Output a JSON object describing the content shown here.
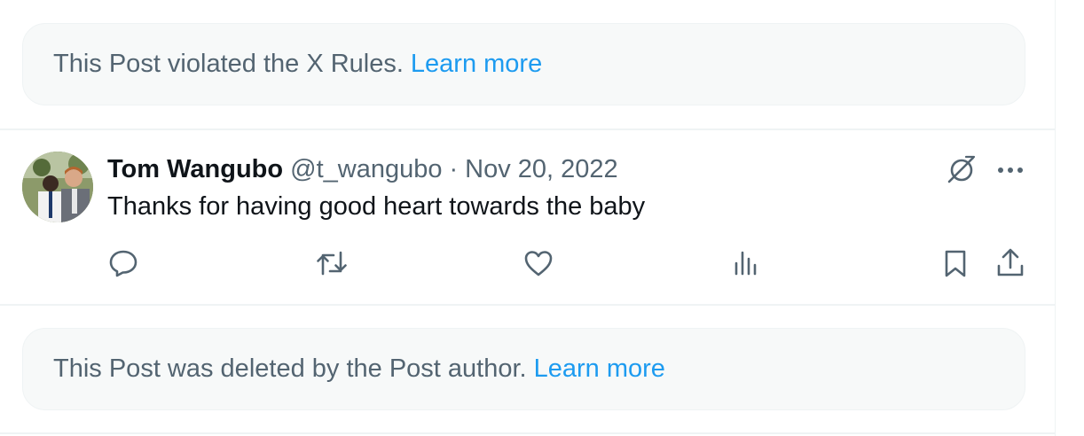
{
  "notices": [
    {
      "text": "This Post violated the X Rules.",
      "link": "Learn more"
    },
    {
      "text": "This Post was deleted by the Post author.",
      "link": "Learn more"
    }
  ],
  "post": {
    "author_name": "Tom Wangubo",
    "author_handle": "@t_wangubo",
    "separator": "·",
    "date": "Nov 20, 2022",
    "text": "Thanks for having good heart towards the baby",
    "header_icons": [
      "grok-icon",
      "more-icon"
    ],
    "action_icons": [
      "reply-icon",
      "repost-icon",
      "like-icon",
      "views-icon",
      "bookmark-icon",
      "share-icon"
    ]
  },
  "colors": {
    "primary_text": "#0f1419",
    "secondary_text": "#536471",
    "link": "#1d9bf0",
    "notice_bg": "#f7f9f9",
    "border": "#eff3f4"
  }
}
